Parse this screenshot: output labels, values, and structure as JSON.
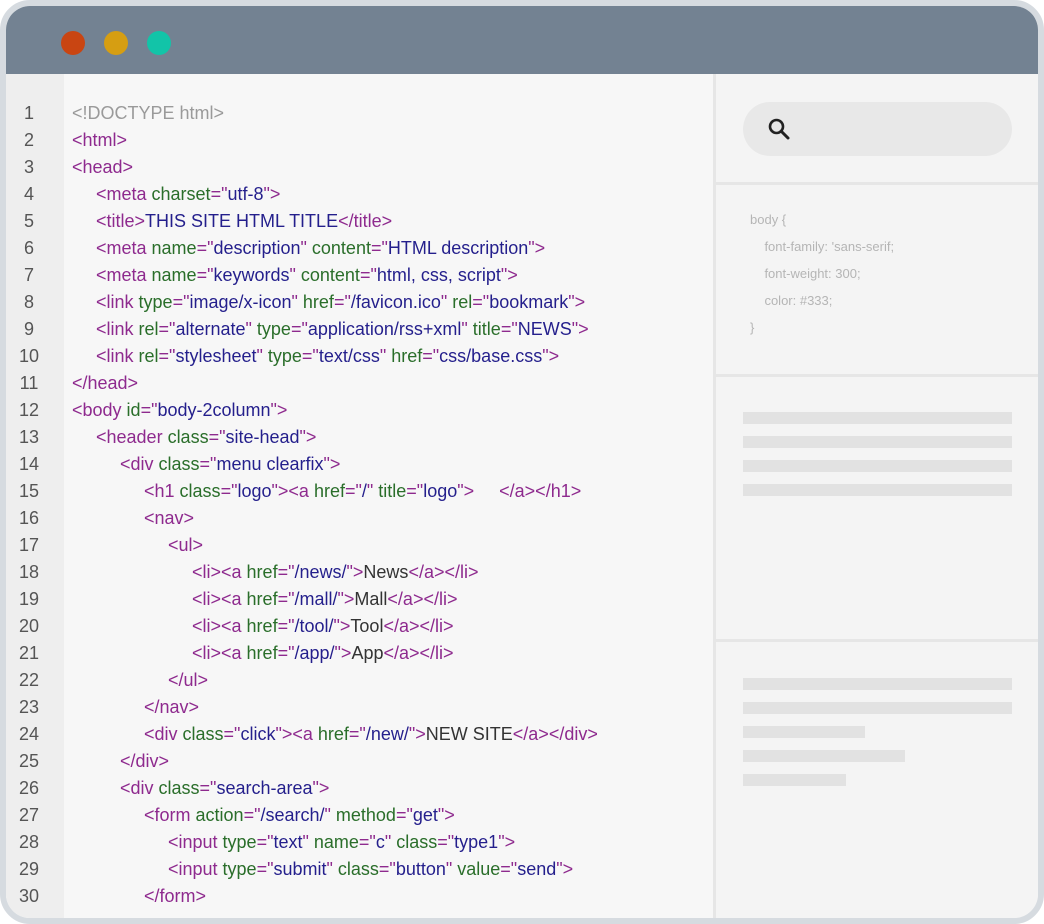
{
  "window": {
    "controls": [
      {
        "name": "close",
        "color": "#c94512"
      },
      {
        "name": "minimize",
        "color": "#d69e12"
      },
      {
        "name": "maximize",
        "color": "#12c4a8"
      }
    ]
  },
  "editor": {
    "lines": [
      {
        "n": "1",
        "indent": 0,
        "tokens": [
          {
            "t": "<!DOCTYPE html>",
            "c": "doc"
          }
        ]
      },
      {
        "n": "2",
        "indent": 0,
        "tokens": [
          {
            "t": "<html>",
            "c": "tag"
          }
        ]
      },
      {
        "n": "3",
        "indent": 0,
        "tokens": [
          {
            "t": "<head>",
            "c": "tag"
          }
        ]
      },
      {
        "n": "4",
        "indent": 1,
        "tokens": [
          {
            "t": "<meta ",
            "c": "tag"
          },
          {
            "t": "charset",
            "c": "attr"
          },
          {
            "t": "=\"",
            "c": "tag"
          },
          {
            "t": "utf-8",
            "c": "val"
          },
          {
            "t": "\">",
            "c": "tag"
          }
        ]
      },
      {
        "n": "5",
        "indent": 1,
        "tokens": [
          {
            "t": "<title>",
            "c": "tag"
          },
          {
            "t": "THIS SITE HTML TITLE",
            "c": "val"
          },
          {
            "t": "</title>",
            "c": "tag"
          }
        ]
      },
      {
        "n": "6",
        "indent": 1,
        "tokens": [
          {
            "t": "<meta ",
            "c": "tag"
          },
          {
            "t": "name",
            "c": "attr"
          },
          {
            "t": "=\"",
            "c": "tag"
          },
          {
            "t": "description",
            "c": "val"
          },
          {
            "t": "\" ",
            "c": "tag"
          },
          {
            "t": "content",
            "c": "attr"
          },
          {
            "t": "=\"",
            "c": "tag"
          },
          {
            "t": "HTML description",
            "c": "val"
          },
          {
            "t": "\">",
            "c": "tag"
          }
        ]
      },
      {
        "n": "7",
        "indent": 1,
        "tokens": [
          {
            "t": "<meta ",
            "c": "tag"
          },
          {
            "t": "name",
            "c": "attr"
          },
          {
            "t": "=\"",
            "c": "tag"
          },
          {
            "t": "keywords",
            "c": "val"
          },
          {
            "t": "\" ",
            "c": "tag"
          },
          {
            "t": "content",
            "c": "attr"
          },
          {
            "t": "=\"",
            "c": "tag"
          },
          {
            "t": "html, css, script",
            "c": "val"
          },
          {
            "t": "\">",
            "c": "tag"
          }
        ]
      },
      {
        "n": "8",
        "indent": 1,
        "tokens": [
          {
            "t": "<link ",
            "c": "tag"
          },
          {
            "t": "type",
            "c": "attr"
          },
          {
            "t": "=\"",
            "c": "tag"
          },
          {
            "t": "image/x-icon",
            "c": "val"
          },
          {
            "t": "\" ",
            "c": "tag"
          },
          {
            "t": "href",
            "c": "attr"
          },
          {
            "t": "=\"",
            "c": "tag"
          },
          {
            "t": "/favicon.ico",
            "c": "val"
          },
          {
            "t": "\" ",
            "c": "tag"
          },
          {
            "t": "rel",
            "c": "attr"
          },
          {
            "t": "=\"",
            "c": "tag"
          },
          {
            "t": "bookmark",
            "c": "val"
          },
          {
            "t": "\">",
            "c": "tag"
          }
        ]
      },
      {
        "n": "9",
        "indent": 1,
        "tokens": [
          {
            "t": "<link ",
            "c": "tag"
          },
          {
            "t": "rel",
            "c": "attr"
          },
          {
            "t": "=\"",
            "c": "tag"
          },
          {
            "t": "alternate",
            "c": "val"
          },
          {
            "t": "\" ",
            "c": "tag"
          },
          {
            "t": "type",
            "c": "attr"
          },
          {
            "t": "=\"",
            "c": "tag"
          },
          {
            "t": "application/rss+xml",
            "c": "val"
          },
          {
            "t": "\" ",
            "c": "tag"
          },
          {
            "t": "title",
            "c": "attr"
          },
          {
            "t": "=\"",
            "c": "tag"
          },
          {
            "t": "NEWS",
            "c": "val"
          },
          {
            "t": "\">",
            "c": "tag"
          }
        ]
      },
      {
        "n": "10",
        "indent": 1,
        "tokens": [
          {
            "t": "<link ",
            "c": "tag"
          },
          {
            "t": "rel",
            "c": "attr"
          },
          {
            "t": "=\"",
            "c": "tag"
          },
          {
            "t": "stylesheet",
            "c": "val"
          },
          {
            "t": "\" ",
            "c": "tag"
          },
          {
            "t": "type",
            "c": "attr"
          },
          {
            "t": "=\"",
            "c": "tag"
          },
          {
            "t": "text/css",
            "c": "val"
          },
          {
            "t": "\" ",
            "c": "tag"
          },
          {
            "t": "href",
            "c": "attr"
          },
          {
            "t": "=\"",
            "c": "tag"
          },
          {
            "t": "css/base.css",
            "c": "val"
          },
          {
            "t": "\">",
            "c": "tag"
          }
        ]
      },
      {
        "n": "11",
        "indent": 0,
        "tokens": [
          {
            "t": "</head>",
            "c": "tag"
          }
        ]
      },
      {
        "n": "12",
        "indent": 0,
        "tokens": [
          {
            "t": "<body ",
            "c": "tag"
          },
          {
            "t": "id",
            "c": "attr"
          },
          {
            "t": "=\"",
            "c": "tag"
          },
          {
            "t": "body-2column",
            "c": "val"
          },
          {
            "t": "\">",
            "c": "tag"
          }
        ]
      },
      {
        "n": "13",
        "indent": 1,
        "tokens": [
          {
            "t": "<header ",
            "c": "tag"
          },
          {
            "t": "class",
            "c": "attr"
          },
          {
            "t": "=\"",
            "c": "tag"
          },
          {
            "t": "site-head",
            "c": "val"
          },
          {
            "t": "\">",
            "c": "tag"
          }
        ]
      },
      {
        "n": "14",
        "indent": 2,
        "tokens": [
          {
            "t": "<div ",
            "c": "tag"
          },
          {
            "t": "class",
            "c": "attr"
          },
          {
            "t": "=\"",
            "c": "tag"
          },
          {
            "t": "menu clearfix",
            "c": "val"
          },
          {
            "t": "\">",
            "c": "tag"
          }
        ]
      },
      {
        "n": "15",
        "indent": 3,
        "tokens": [
          {
            "t": "<h1 ",
            "c": "tag"
          },
          {
            "t": "class",
            "c": "attr"
          },
          {
            "t": "=\"",
            "c": "tag"
          },
          {
            "t": "logo",
            "c": "val"
          },
          {
            "t": "\"><a ",
            "c": "tag"
          },
          {
            "t": "href",
            "c": "attr"
          },
          {
            "t": "=\"",
            "c": "tag"
          },
          {
            "t": "/",
            "c": "val"
          },
          {
            "t": "\" ",
            "c": "tag"
          },
          {
            "t": "title",
            "c": "attr"
          },
          {
            "t": "=\"",
            "c": "tag"
          },
          {
            "t": "logo",
            "c": "val"
          },
          {
            "t": "\">     </a></h1>",
            "c": "tag"
          }
        ]
      },
      {
        "n": "16",
        "indent": 3,
        "tokens": [
          {
            "t": "<nav>",
            "c": "tag"
          }
        ]
      },
      {
        "n": "17",
        "indent": 4,
        "tokens": [
          {
            "t": "<ul>",
            "c": "tag"
          }
        ]
      },
      {
        "n": "18",
        "indent": 5,
        "tokens": [
          {
            "t": "<li><a ",
            "c": "tag"
          },
          {
            "t": "href",
            "c": "attr"
          },
          {
            "t": "=\"",
            "c": "tag"
          },
          {
            "t": "/news/",
            "c": "val"
          },
          {
            "t": "\">",
            "c": "tag"
          },
          {
            "t": "News",
            "c": "txt"
          },
          {
            "t": "</a></li>",
            "c": "tag"
          }
        ]
      },
      {
        "n": "19",
        "indent": 5,
        "tokens": [
          {
            "t": "<li><a ",
            "c": "tag"
          },
          {
            "t": "href",
            "c": "attr"
          },
          {
            "t": "=\"",
            "c": "tag"
          },
          {
            "t": "/mall/",
            "c": "val"
          },
          {
            "t": "\">",
            "c": "tag"
          },
          {
            "t": "Mall",
            "c": "txt"
          },
          {
            "t": "</a></li>",
            "c": "tag"
          }
        ]
      },
      {
        "n": "20",
        "indent": 5,
        "tokens": [
          {
            "t": "<li><a ",
            "c": "tag"
          },
          {
            "t": "href",
            "c": "attr"
          },
          {
            "t": "=\"",
            "c": "tag"
          },
          {
            "t": "/tool/",
            "c": "val"
          },
          {
            "t": "\">",
            "c": "tag"
          },
          {
            "t": "Tool",
            "c": "txt"
          },
          {
            "t": "</a></li>",
            "c": "tag"
          }
        ]
      },
      {
        "n": "21",
        "indent": 5,
        "tokens": [
          {
            "t": "<li><a ",
            "c": "tag"
          },
          {
            "t": "href",
            "c": "attr"
          },
          {
            "t": "=\"",
            "c": "tag"
          },
          {
            "t": "/app/",
            "c": "val"
          },
          {
            "t": "\">",
            "c": "tag"
          },
          {
            "t": "App",
            "c": "txt"
          },
          {
            "t": "</a></li>",
            "c": "tag"
          }
        ]
      },
      {
        "n": "22",
        "indent": 4,
        "tokens": [
          {
            "t": "</ul>",
            "c": "tag"
          }
        ]
      },
      {
        "n": "23",
        "indent": 3,
        "tokens": [
          {
            "t": "</nav>",
            "c": "tag"
          }
        ]
      },
      {
        "n": "24",
        "indent": 3,
        "tokens": [
          {
            "t": "<div ",
            "c": "tag"
          },
          {
            "t": "class",
            "c": "attr"
          },
          {
            "t": "=\"",
            "c": "tag"
          },
          {
            "t": "click",
            "c": "val"
          },
          {
            "t": "\"><a ",
            "c": "tag"
          },
          {
            "t": "href",
            "c": "attr"
          },
          {
            "t": "=\"",
            "c": "tag"
          },
          {
            "t": "/new/",
            "c": "val"
          },
          {
            "t": "\">",
            "c": "tag"
          },
          {
            "t": "NEW SITE",
            "c": "txt"
          },
          {
            "t": "</a></div>",
            "c": "tag"
          }
        ]
      },
      {
        "n": "25",
        "indent": 2,
        "tokens": [
          {
            "t": "</div>",
            "c": "tag"
          }
        ]
      },
      {
        "n": "26",
        "indent": 2,
        "tokens": [
          {
            "t": "<div ",
            "c": "tag"
          },
          {
            "t": "class",
            "c": "attr"
          },
          {
            "t": "=\"",
            "c": "tag"
          },
          {
            "t": "search-area",
            "c": "val"
          },
          {
            "t": "\">",
            "c": "tag"
          }
        ]
      },
      {
        "n": "27",
        "indent": 3,
        "tokens": [
          {
            "t": "<form ",
            "c": "tag"
          },
          {
            "t": "action",
            "c": "attr"
          },
          {
            "t": "=\"",
            "c": "tag"
          },
          {
            "t": "/search/",
            "c": "val"
          },
          {
            "t": "\" ",
            "c": "tag"
          },
          {
            "t": "method",
            "c": "attr"
          },
          {
            "t": "=\"",
            "c": "tag"
          },
          {
            "t": "get",
            "c": "val"
          },
          {
            "t": "\">",
            "c": "tag"
          }
        ]
      },
      {
        "n": "28",
        "indent": 4,
        "tokens": [
          {
            "t": "<input ",
            "c": "tag"
          },
          {
            "t": "type",
            "c": "attr"
          },
          {
            "t": "=\"",
            "c": "tag"
          },
          {
            "t": "text",
            "c": "val"
          },
          {
            "t": "\" ",
            "c": "tag"
          },
          {
            "t": "name",
            "c": "attr"
          },
          {
            "t": "=\"",
            "c": "tag"
          },
          {
            "t": "c",
            "c": "val"
          },
          {
            "t": "\" ",
            "c": "tag"
          },
          {
            "t": "class",
            "c": "attr"
          },
          {
            "t": "=\"",
            "c": "tag"
          },
          {
            "t": "type1",
            "c": "val"
          },
          {
            "t": "\">",
            "c": "tag"
          }
        ]
      },
      {
        "n": "29",
        "indent": 4,
        "tokens": [
          {
            "t": "<input ",
            "c": "tag"
          },
          {
            "t": "type",
            "c": "attr"
          },
          {
            "t": "=\"",
            "c": "tag"
          },
          {
            "t": "submit",
            "c": "val"
          },
          {
            "t": "\" ",
            "c": "tag"
          },
          {
            "t": "class",
            "c": "attr"
          },
          {
            "t": "=\"",
            "c": "tag"
          },
          {
            "t": "button",
            "c": "val"
          },
          {
            "t": "\" ",
            "c": "tag"
          },
          {
            "t": "value",
            "c": "attr"
          },
          {
            "t": "=\"",
            "c": "tag"
          },
          {
            "t": "send",
            "c": "val"
          },
          {
            "t": "\">",
            "c": "tag"
          }
        ]
      },
      {
        "n": "30",
        "indent": 3,
        "tokens": [
          {
            "t": "</form>",
            "c": "tag"
          }
        ]
      }
    ]
  },
  "sidebar": {
    "search_icon": "search-icon",
    "css_snippet": [
      "body {",
      "    font-family: 'sans-serif;",
      "    font-weight: 300;",
      "    color: #333;",
      "}"
    ]
  },
  "colors": {
    "titlebar": "#738292",
    "tag": "#8e2a8e",
    "attr": "#2a6e2a",
    "val": "#241f8c",
    "doc": "#9a9a9a",
    "txt": "#333333"
  }
}
